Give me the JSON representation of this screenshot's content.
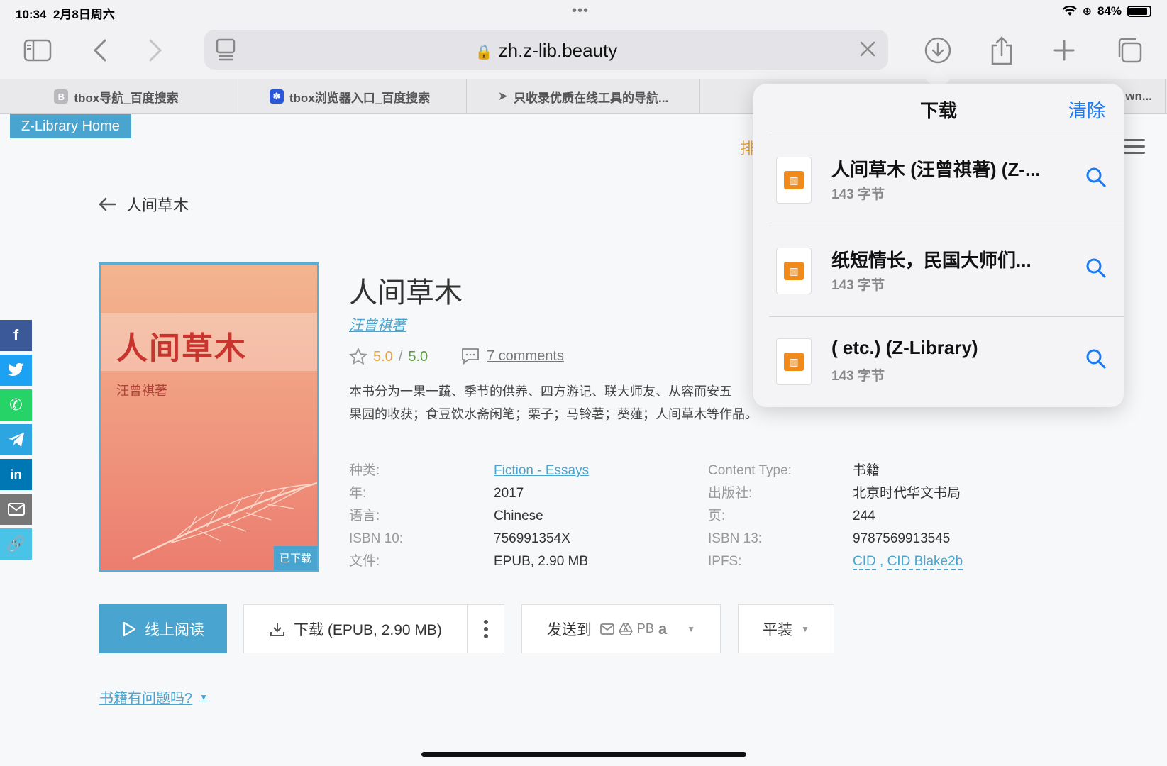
{
  "status": {
    "time": "10:34",
    "date": "2月8日周六",
    "battery": "84%",
    "battery_level": 0.84
  },
  "browser": {
    "url": "zh.z-lib.beauty",
    "tabs": [
      {
        "label": "tbox导航_百度搜索",
        "fav": "B"
      },
      {
        "label": "tbox浏览器入口_百度搜索",
        "fav": "du"
      },
      {
        "label": "只收录优质在线工具的导航...",
        "fav": ""
      },
      {
        "label": "wn...",
        "fav": ""
      }
    ]
  },
  "page": {
    "home_label": "Z-Library Home",
    "orange_fragment": "排",
    "back_label": "人间草木",
    "book": {
      "title": "人间草木",
      "author": "汪曾祺著",
      "rating": "5.0",
      "rating_max": "5.0",
      "comments": "7 comments",
      "description_line1": "本书分为一果一蔬、季节的供养、四方游记、联大师友、从容而安五",
      "description_line2": "果园的收获；食豆饮水斋闲笔；栗子；马铃薯；葵薤；人间草木等作品。",
      "cover_title": "人间草木",
      "cover_author": "汪曾祺著",
      "downloaded_badge": "已下载"
    },
    "props_left": [
      {
        "label": "种类:",
        "value": "Fiction - Essays",
        "link": true
      },
      {
        "label": "年:",
        "value": "2017"
      },
      {
        "label": "语言:",
        "value": "Chinese"
      },
      {
        "label": "ISBN 10:",
        "value": "756991354X"
      },
      {
        "label": "文件:",
        "value": "EPUB, 2.90 MB"
      }
    ],
    "props_right": [
      {
        "label": "Content Type:",
        "value": "书籍"
      },
      {
        "label": "出版社:",
        "value": "北京时代华文书局"
      },
      {
        "label": "页:",
        "value": "244"
      },
      {
        "label": "ISBN 13:",
        "value": "9787569913545"
      },
      {
        "label": "IPFS:",
        "cid": "CID",
        "sep": ",",
        "cid2": "CID Blake2b"
      }
    ],
    "buttons": {
      "read": "线上阅读",
      "download": "下载 (EPUB, 2.90 MB)",
      "send_to": "发送到",
      "send_targets": "PB",
      "amazon": "a",
      "binding": "平装"
    },
    "problem_link": "书籍有问题吗?"
  },
  "downloads": {
    "title": "下载",
    "clear": "清除",
    "items": [
      {
        "name": "人间草木 (汪曾祺著) (Z-...",
        "size": "143 字节"
      },
      {
        "name": "纸短情长，民国大师们...",
        "size": "143 字节"
      },
      {
        "name": "( etc.) (Z-Library)",
        "size": "143 字节"
      }
    ]
  },
  "colors": {
    "accent": "#49a5cf",
    "ios_blue": "#1a7cf5",
    "rating": "#e8a23a"
  }
}
